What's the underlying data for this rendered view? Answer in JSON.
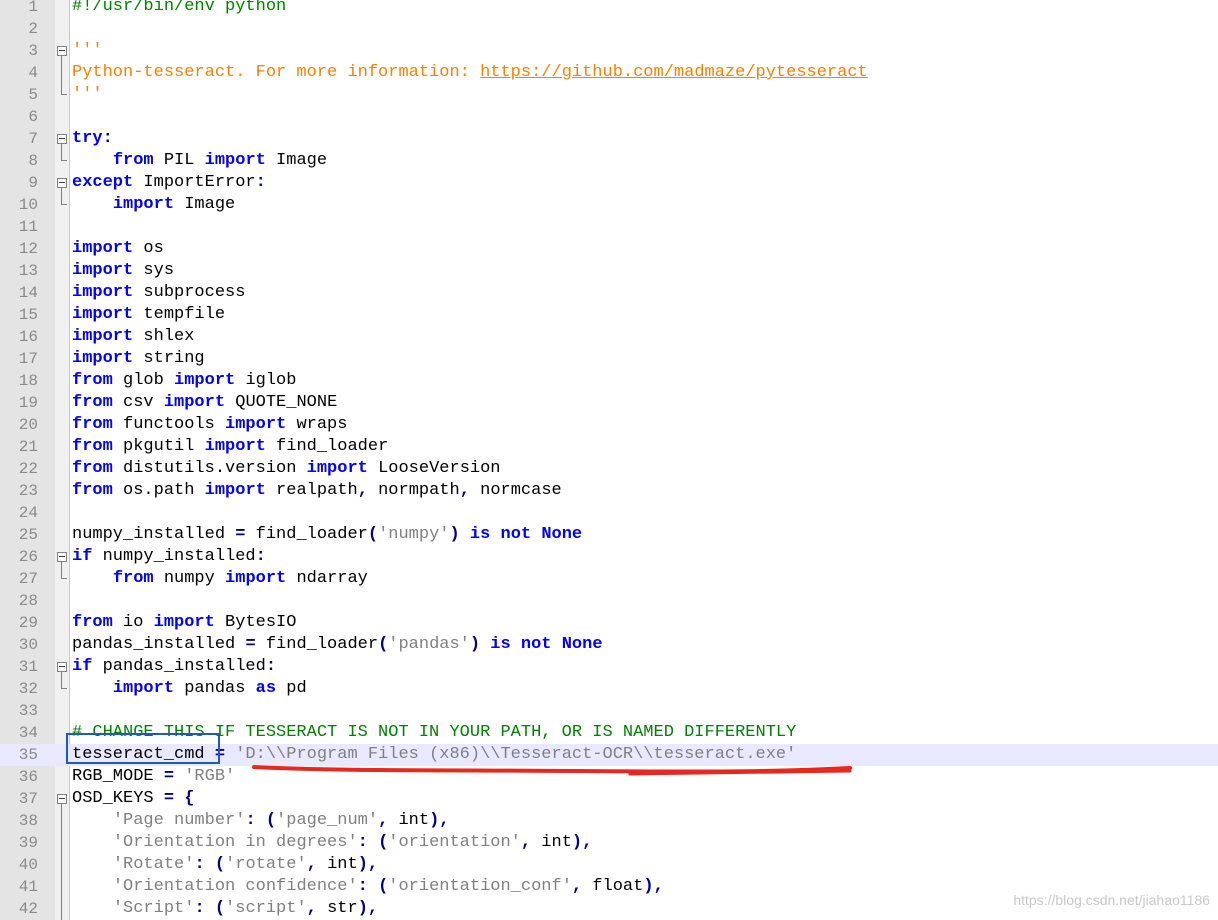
{
  "lines": [
    {
      "n": "1",
      "t": [
        {
          "c": "cm",
          "s": "#!/usr/bin/env python"
        }
      ]
    },
    {
      "n": "2",
      "t": []
    },
    {
      "n": "3",
      "fold": "start",
      "t": [
        {
          "c": "doc",
          "s": "'''"
        }
      ]
    },
    {
      "n": "4",
      "fold": "mid",
      "t": [
        {
          "c": "doc",
          "s": "Python-tesseract. For more information: "
        },
        {
          "c": "url",
          "s": "https://github.com/madmaze/pytesseract"
        }
      ]
    },
    {
      "n": "5",
      "fold": "end",
      "t": [
        {
          "c": "doc",
          "s": "'''"
        }
      ]
    },
    {
      "n": "6",
      "t": []
    },
    {
      "n": "7",
      "fold": "start",
      "t": [
        {
          "c": "kw",
          "s": "try"
        },
        {
          "c": "op",
          "s": ":"
        }
      ]
    },
    {
      "n": "8",
      "fold": "end",
      "t": [
        {
          "c": "",
          "s": "    "
        },
        {
          "c": "kw",
          "s": "from"
        },
        {
          "c": "",
          "s": " PIL "
        },
        {
          "c": "kw",
          "s": "import"
        },
        {
          "c": "",
          "s": " Image"
        }
      ]
    },
    {
      "n": "9",
      "fold": "start",
      "t": [
        {
          "c": "kw",
          "s": "except"
        },
        {
          "c": "",
          "s": " ImportError"
        },
        {
          "c": "op",
          "s": ":"
        }
      ]
    },
    {
      "n": "10",
      "fold": "end",
      "t": [
        {
          "c": "",
          "s": "    "
        },
        {
          "c": "kw",
          "s": "import"
        },
        {
          "c": "",
          "s": " Image"
        }
      ]
    },
    {
      "n": "11",
      "t": []
    },
    {
      "n": "12",
      "t": [
        {
          "c": "kw",
          "s": "import"
        },
        {
          "c": "",
          "s": " os"
        }
      ]
    },
    {
      "n": "13",
      "t": [
        {
          "c": "kw",
          "s": "import"
        },
        {
          "c": "",
          "s": " sys"
        }
      ]
    },
    {
      "n": "14",
      "t": [
        {
          "c": "kw",
          "s": "import"
        },
        {
          "c": "",
          "s": " subprocess"
        }
      ]
    },
    {
      "n": "15",
      "t": [
        {
          "c": "kw",
          "s": "import"
        },
        {
          "c": "",
          "s": " tempfile"
        }
      ]
    },
    {
      "n": "16",
      "t": [
        {
          "c": "kw",
          "s": "import"
        },
        {
          "c": "",
          "s": " shlex"
        }
      ]
    },
    {
      "n": "17",
      "t": [
        {
          "c": "kw",
          "s": "import"
        },
        {
          "c": "",
          "s": " string"
        }
      ]
    },
    {
      "n": "18",
      "t": [
        {
          "c": "kw",
          "s": "from"
        },
        {
          "c": "",
          "s": " glob "
        },
        {
          "c": "kw",
          "s": "import"
        },
        {
          "c": "",
          "s": " iglob"
        }
      ]
    },
    {
      "n": "19",
      "t": [
        {
          "c": "kw",
          "s": "from"
        },
        {
          "c": "",
          "s": " csv "
        },
        {
          "c": "kw",
          "s": "import"
        },
        {
          "c": "",
          "s": " QUOTE_NONE"
        }
      ]
    },
    {
      "n": "20",
      "t": [
        {
          "c": "kw",
          "s": "from"
        },
        {
          "c": "",
          "s": " functools "
        },
        {
          "c": "kw",
          "s": "import"
        },
        {
          "c": "",
          "s": " wraps"
        }
      ]
    },
    {
      "n": "21",
      "t": [
        {
          "c": "kw",
          "s": "from"
        },
        {
          "c": "",
          "s": " pkgutil "
        },
        {
          "c": "kw",
          "s": "import"
        },
        {
          "c": "",
          "s": " find_loader"
        }
      ]
    },
    {
      "n": "22",
      "t": [
        {
          "c": "kw",
          "s": "from"
        },
        {
          "c": "",
          "s": " distutils.version "
        },
        {
          "c": "kw",
          "s": "import"
        },
        {
          "c": "",
          "s": " LooseVersion"
        }
      ]
    },
    {
      "n": "23",
      "t": [
        {
          "c": "kw",
          "s": "from"
        },
        {
          "c": "",
          "s": " os.path "
        },
        {
          "c": "kw",
          "s": "import"
        },
        {
          "c": "",
          "s": " realpath"
        },
        {
          "c": "op",
          "s": ","
        },
        {
          "c": "",
          "s": " normpath"
        },
        {
          "c": "op",
          "s": ","
        },
        {
          "c": "",
          "s": " normcase"
        }
      ]
    },
    {
      "n": "24",
      "t": []
    },
    {
      "n": "25",
      "t": [
        {
          "c": "",
          "s": "numpy_installed "
        },
        {
          "c": "op",
          "s": "="
        },
        {
          "c": "",
          "s": " find_loader"
        },
        {
          "c": "op",
          "s": "("
        },
        {
          "c": "str",
          "s": "'numpy'"
        },
        {
          "c": "op",
          "s": ")"
        },
        {
          "c": "",
          "s": " "
        },
        {
          "c": "kw",
          "s": "is"
        },
        {
          "c": "",
          "s": " "
        },
        {
          "c": "kw",
          "s": "not"
        },
        {
          "c": "",
          "s": " "
        },
        {
          "c": "kw",
          "s": "None"
        }
      ]
    },
    {
      "n": "26",
      "fold": "start",
      "t": [
        {
          "c": "kw",
          "s": "if"
        },
        {
          "c": "",
          "s": " numpy_installed"
        },
        {
          "c": "op",
          "s": ":"
        }
      ]
    },
    {
      "n": "27",
      "fold": "end",
      "t": [
        {
          "c": "",
          "s": "    "
        },
        {
          "c": "kw",
          "s": "from"
        },
        {
          "c": "",
          "s": " numpy "
        },
        {
          "c": "kw",
          "s": "import"
        },
        {
          "c": "",
          "s": " ndarray"
        }
      ]
    },
    {
      "n": "28",
      "t": []
    },
    {
      "n": "29",
      "t": [
        {
          "c": "kw",
          "s": "from"
        },
        {
          "c": "",
          "s": " io "
        },
        {
          "c": "kw",
          "s": "import"
        },
        {
          "c": "",
          "s": " BytesIO"
        }
      ]
    },
    {
      "n": "30",
      "t": [
        {
          "c": "",
          "s": "pandas_installed "
        },
        {
          "c": "op",
          "s": "="
        },
        {
          "c": "",
          "s": " find_loader"
        },
        {
          "c": "op",
          "s": "("
        },
        {
          "c": "str",
          "s": "'pandas'"
        },
        {
          "c": "op",
          "s": ")"
        },
        {
          "c": "",
          "s": " "
        },
        {
          "c": "kw",
          "s": "is"
        },
        {
          "c": "",
          "s": " "
        },
        {
          "c": "kw",
          "s": "not"
        },
        {
          "c": "",
          "s": " "
        },
        {
          "c": "kw",
          "s": "None"
        }
      ]
    },
    {
      "n": "31",
      "fold": "start",
      "t": [
        {
          "c": "kw",
          "s": "if"
        },
        {
          "c": "",
          "s": " pandas_installed"
        },
        {
          "c": "op",
          "s": ":"
        }
      ]
    },
    {
      "n": "32",
      "fold": "end",
      "t": [
        {
          "c": "",
          "s": "    "
        },
        {
          "c": "kw",
          "s": "import"
        },
        {
          "c": "",
          "s": " pandas "
        },
        {
          "c": "kw",
          "s": "as"
        },
        {
          "c": "",
          "s": " pd"
        }
      ]
    },
    {
      "n": "33",
      "t": []
    },
    {
      "n": "34",
      "t": [
        {
          "c": "cm",
          "s": "# CHANGE THIS IF TESSERACT IS NOT IN YOUR PATH, OR IS NAMED DIFFERENTLY"
        }
      ]
    },
    {
      "n": "35",
      "cur": true,
      "t": [
        {
          "c": "",
          "s": "tesseract_cmd "
        },
        {
          "c": "op",
          "s": "="
        },
        {
          "c": "",
          "s": " "
        },
        {
          "c": "str",
          "s": "'D:\\\\Program Files (x86)\\\\Tesseract-OCR\\\\tesseract.exe'"
        }
      ]
    },
    {
      "n": "36",
      "t": [
        {
          "c": "",
          "s": "RGB_MODE "
        },
        {
          "c": "op",
          "s": "="
        },
        {
          "c": "",
          "s": " "
        },
        {
          "c": "str",
          "s": "'RGB'"
        }
      ]
    },
    {
      "n": "37",
      "fold": "start",
      "t": [
        {
          "c": "",
          "s": "OSD_KEYS "
        },
        {
          "c": "op",
          "s": "="
        },
        {
          "c": "",
          "s": " "
        },
        {
          "c": "op",
          "s": "{"
        }
      ]
    },
    {
      "n": "38",
      "fold": "mid",
      "t": [
        {
          "c": "",
          "s": "    "
        },
        {
          "c": "str",
          "s": "'Page number'"
        },
        {
          "c": "op",
          "s": ":"
        },
        {
          "c": "",
          "s": " "
        },
        {
          "c": "op",
          "s": "("
        },
        {
          "c": "str",
          "s": "'page_num'"
        },
        {
          "c": "op",
          "s": ","
        },
        {
          "c": "",
          "s": " int"
        },
        {
          "c": "op",
          "s": "),"
        }
      ]
    },
    {
      "n": "39",
      "fold": "mid",
      "t": [
        {
          "c": "",
          "s": "    "
        },
        {
          "c": "str",
          "s": "'Orientation in degrees'"
        },
        {
          "c": "op",
          "s": ":"
        },
        {
          "c": "",
          "s": " "
        },
        {
          "c": "op",
          "s": "("
        },
        {
          "c": "str",
          "s": "'orientation'"
        },
        {
          "c": "op",
          "s": ","
        },
        {
          "c": "",
          "s": " int"
        },
        {
          "c": "op",
          "s": "),"
        }
      ]
    },
    {
      "n": "40",
      "fold": "mid",
      "t": [
        {
          "c": "",
          "s": "    "
        },
        {
          "c": "str",
          "s": "'Rotate'"
        },
        {
          "c": "op",
          "s": ":"
        },
        {
          "c": "",
          "s": " "
        },
        {
          "c": "op",
          "s": "("
        },
        {
          "c": "str",
          "s": "'rotate'"
        },
        {
          "c": "op",
          "s": ","
        },
        {
          "c": "",
          "s": " int"
        },
        {
          "c": "op",
          "s": "),"
        }
      ]
    },
    {
      "n": "41",
      "fold": "mid",
      "t": [
        {
          "c": "",
          "s": "    "
        },
        {
          "c": "str",
          "s": "'Orientation confidence'"
        },
        {
          "c": "op",
          "s": ":"
        },
        {
          "c": "",
          "s": " "
        },
        {
          "c": "op",
          "s": "("
        },
        {
          "c": "str",
          "s": "'orientation_conf'"
        },
        {
          "c": "op",
          "s": ","
        },
        {
          "c": "",
          "s": " float"
        },
        {
          "c": "op",
          "s": "),"
        }
      ]
    },
    {
      "n": "42",
      "fold": "mid",
      "t": [
        {
          "c": "",
          "s": "    "
        },
        {
          "c": "str",
          "s": "'Script'"
        },
        {
          "c": "op",
          "s": ":"
        },
        {
          "c": "",
          "s": " "
        },
        {
          "c": "op",
          "s": "("
        },
        {
          "c": "str",
          "s": "'script'"
        },
        {
          "c": "op",
          "s": ","
        },
        {
          "c": "",
          "s": " str"
        },
        {
          "c": "op",
          "s": "),"
        }
      ]
    }
  ],
  "watermark": "https://blog.csdn.net/jiahao1186",
  "annotations": {
    "box_color": "#2155c8",
    "underline_color": "#e8281e"
  }
}
